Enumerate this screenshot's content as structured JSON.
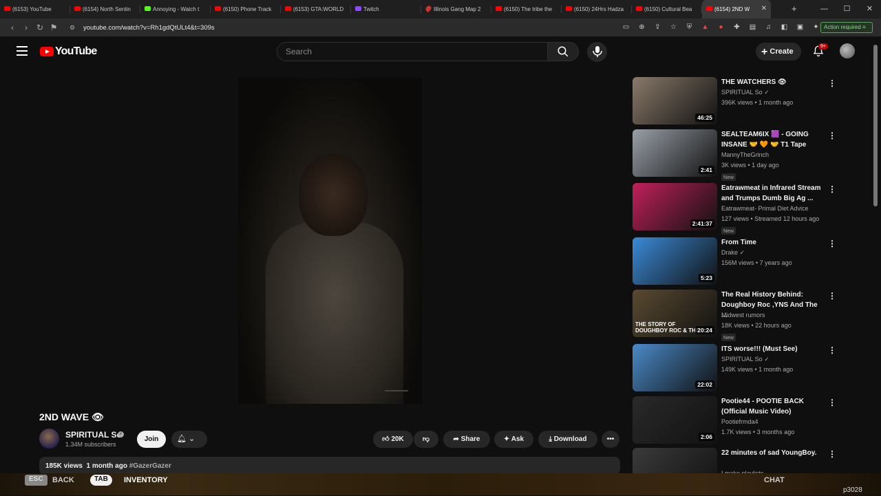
{
  "browser": {
    "tabs": [
      {
        "label": "(6153) YouTube",
        "icon": "youtube-icon"
      },
      {
        "label": "(6154) North Sentin",
        "icon": "youtube-icon"
      },
      {
        "label": "Annoying - Watch t",
        "icon": "kick-icon"
      },
      {
        "label": "(6150) Phone Track",
        "icon": "youtube-icon"
      },
      {
        "label": "(6153) GTA:WORLD",
        "icon": "youtube-icon"
      },
      {
        "label": "Twitch",
        "icon": "twitch-icon"
      },
      {
        "label": "Illinois Gang Map 2",
        "icon": "map-pin-icon"
      },
      {
        "label": "(6150) The tribe the",
        "icon": "youtube-icon"
      },
      {
        "label": "(6150) 24Hrs Hadza",
        "icon": "youtube-icon"
      },
      {
        "label": "(6150) Cultural Bea",
        "icon": "youtube-icon"
      },
      {
        "label": "(6154) 2ND W",
        "icon": "youtube-icon",
        "active": true
      }
    ],
    "url": "youtube.com/watch?v=Rh1gdQtULt4&t=309s",
    "action_required": "Action required"
  },
  "header": {
    "logo": "YouTube",
    "search_placeholder": "Search",
    "create_label": "Create",
    "notifications_badge": "9+"
  },
  "video": {
    "title": "2ND WAVE",
    "title_emoji": "👁",
    "channel": "SPIRITUAL So",
    "subscribers": "1.34M subscribers",
    "join_label": "Join",
    "likes": "20K",
    "share_label": "Share",
    "ask_label": "Ask",
    "download_label": "Download",
    "views": "185K views",
    "age": "1 month ago",
    "hashtag": "#GazerGazer"
  },
  "recommendations": [
    {
      "title": "THE WATCHERS 👁",
      "channel": "SPIRITUAL So",
      "verified": true,
      "meta": "396K views • 1 month ago",
      "duration": "46:25",
      "new": false,
      "color": "#8a7a6a"
    },
    {
      "title": "SEALTEAM6IX 🟪 - GOING INSANE 🤝 🧡 🤝 T1 Tape",
      "channel": "MannyTheGrinch",
      "verified": false,
      "meta": "3K views • 1 day ago",
      "duration": "2:41",
      "new": true,
      "color": "#9aa0a8"
    },
    {
      "title": "Eatrawmeat in Infrared Stream and Trumps Dumb Big Ag ...",
      "channel": "Eatrawmeat- Primal Diet Advice",
      "verified": false,
      "meta": "127 views • Streamed 12 hours ago",
      "duration": "2:41:37",
      "new": true,
      "color": "#c0205a"
    },
    {
      "title": "From Time",
      "channel": "Drake",
      "verified": true,
      "meta": "156M views • 7 years ago",
      "duration": "5:23",
      "new": false,
      "color": "#3a8ad8"
    },
    {
      "title": "The Real History Behind: Doughboy Roc ,YNS And The ...",
      "channel": "Midwest rumors",
      "verified": false,
      "meta": "18K views • 22 hours ago",
      "duration": "20:24",
      "new": true,
      "color": "#5a4a30",
      "thumb_text": "THE STORY OF DOUGHBOY ROC & THE"
    },
    {
      "title": "ITS worse!!! (Must See)",
      "channel": "SPIRITUAL So",
      "verified": true,
      "meta": "149K views • 1 month ago",
      "duration": "22:02",
      "new": false,
      "color": "#4a8ac8"
    },
    {
      "title": "Pootie44 - POOTIE BACK (Official Music Video)",
      "channel": "Pootiefrmda4",
      "verified": false,
      "meta": "1.7K views • 3 months ago",
      "duration": "2:06",
      "new": false,
      "color": "#2a2a2a"
    },
    {
      "title": "22 minutes of sad YoungBoy.",
      "channel": "I make playlists.",
      "verified": false,
      "meta": "",
      "duration": "",
      "new": false,
      "color": "#3a3a3a"
    }
  ],
  "overlay": {
    "esc": "ESC",
    "back": "BACK",
    "tab": "TAB",
    "inventory": "INVENTORY",
    "chat": "CHAT",
    "code": "p3028"
  }
}
